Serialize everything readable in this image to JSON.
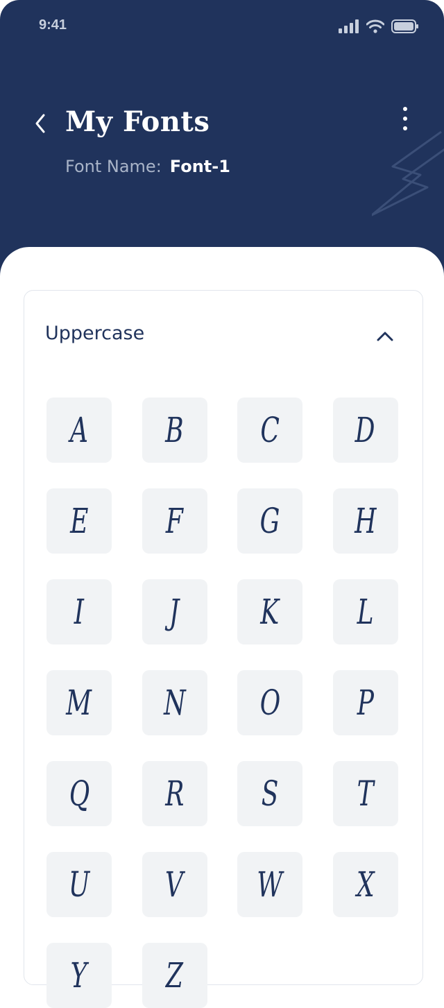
{
  "status": {
    "time": "9:41"
  },
  "header": {
    "title": "My Fonts",
    "font_name_label": "Font Name:",
    "font_name_value": "Font-1"
  },
  "section": {
    "title": "Uppercase",
    "letters": [
      "A",
      "B",
      "C",
      "D",
      "E",
      "F",
      "G",
      "H",
      "I",
      "J",
      "K",
      "L",
      "M",
      "N",
      "O",
      "P",
      "Q",
      "R",
      "S",
      "T",
      "U",
      "V",
      "W",
      "X",
      "Y",
      "Z"
    ]
  },
  "colors": {
    "header_bg": "#20335c",
    "tile_bg": "#f1f3f5",
    "text_dark": "#20335c"
  }
}
